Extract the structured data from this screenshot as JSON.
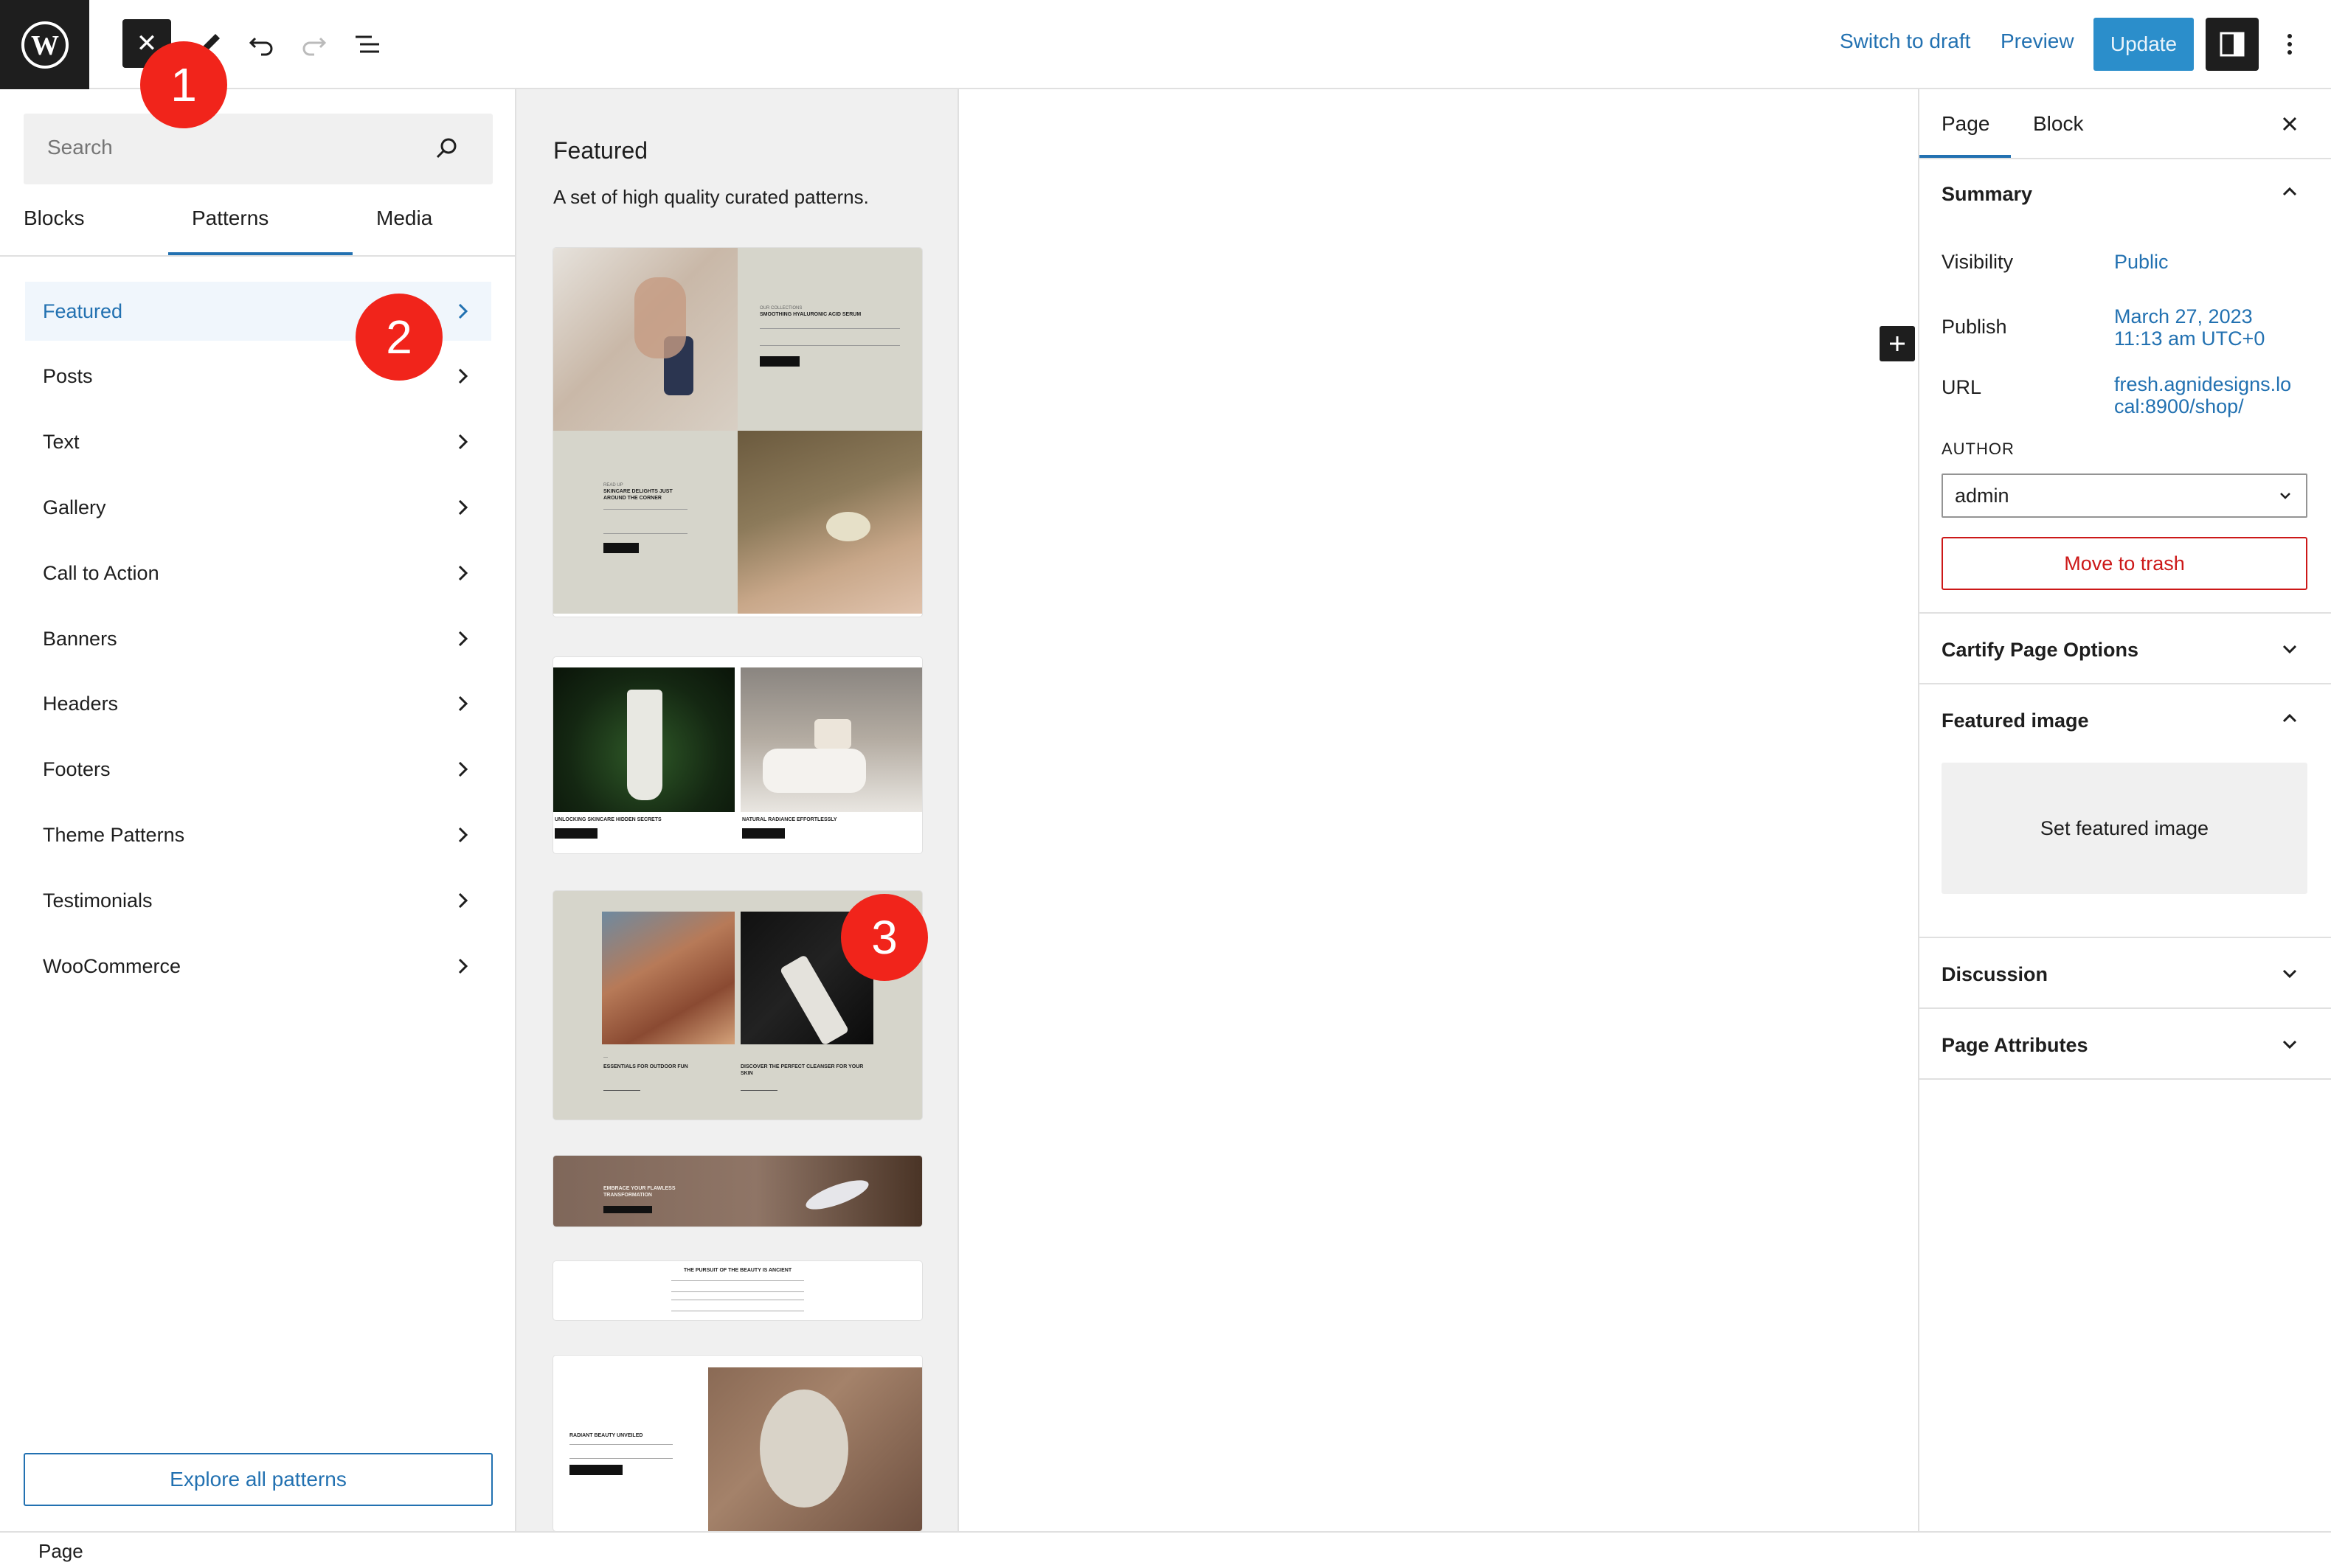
{
  "topbar": {
    "switch_to_draft": "Switch to draft",
    "preview": "Preview",
    "update": "Update"
  },
  "badges": [
    "1",
    "2",
    "3"
  ],
  "inserter": {
    "search_placeholder": "Search",
    "tabs": [
      "Blocks",
      "Patterns",
      "Media"
    ],
    "categories": [
      "Featured",
      "Posts",
      "Text",
      "Gallery",
      "Call to Action",
      "Banners",
      "Headers",
      "Footers",
      "Theme Patterns",
      "Testimonials",
      "WooCommerce"
    ],
    "explore_label": "Explore all patterns"
  },
  "pattern_panel": {
    "title": "Featured",
    "description": "A set of high quality curated patterns.",
    "card1": {
      "tag1": "OUR COLLECTIONS",
      "heading1": "SMOOTHING HYALURONIC ACID SERUM",
      "tag2": "READ UP",
      "heading2": "SKINCARE DELIGHTS JUST AROUND THE CORNER"
    },
    "card2": {
      "caption1": "UNLOCKING SKINCARE HIDDEN SECRETS",
      "caption2": "NATURAL RADIANCE EFFORTLESSLY"
    },
    "card3": {
      "caption1": "ESSENTIALS FOR OUTDOOR FUN",
      "caption2": "DISCOVER THE PERFECT CLEANSER FOR YOUR SKIN"
    },
    "card4": {
      "heading": "EMBRACE YOUR FLAWLESS TRANSFORMATION"
    },
    "card5": {
      "heading": "THE PURSUIT OF THE BEAUTY IS ANCIENT"
    },
    "card6": {
      "heading": "RADIANT BEAUTY UNVEILED"
    }
  },
  "settings": {
    "tabs": [
      "Page",
      "Block"
    ],
    "summary_title": "Summary",
    "visibility_label": "Visibility",
    "visibility_value": "Public",
    "publish_label": "Publish",
    "publish_date": "March 27, 2023",
    "publish_time": "11:13 am UTC+0",
    "url_label": "URL",
    "url_line1": "fresh.agnidesigns.lo",
    "url_line2": "cal:8900/shop/",
    "author_label": "AUTHOR",
    "author_value": "admin",
    "trash_label": "Move to trash",
    "cartify_title": "Cartify Page Options",
    "featured_image_title": "Featured image",
    "set_featured_label": "Set featured image",
    "discussion_title": "Discussion",
    "attributes_title": "Page Attributes"
  },
  "footer": {
    "breadcrumb": "Page"
  },
  "colors": {
    "accent": "#2271b1",
    "dark": "#1e1e1e",
    "badge": "#f1241b",
    "danger": "#cc1818"
  }
}
